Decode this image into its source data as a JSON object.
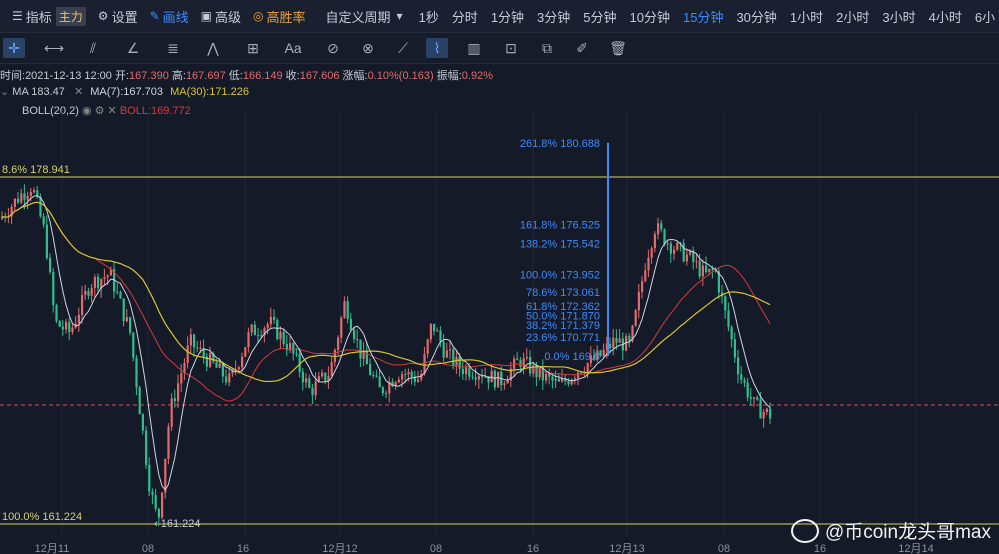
{
  "topbar": {
    "indicators_label": "指标",
    "main_badge": "主力",
    "settings_label": "设置",
    "draw_label": "画线",
    "advanced_label": "高级",
    "winrate_label": "高胜率",
    "custom_period_label": "自定义周期",
    "periods": [
      "1秒",
      "分时",
      "1分钟",
      "3分钟",
      "5分钟",
      "10分钟",
      "15分钟",
      "30分钟",
      "1小时",
      "2小时",
      "3小时",
      "4小时",
      "6小"
    ],
    "active_period": "15分钟"
  },
  "ohlc": {
    "time_label": "时间:",
    "time": "2021-12-13 12:00",
    "open_label": "开:",
    "open": "167.390",
    "high_label": "高:",
    "high": "167.697",
    "low_label": "低:",
    "low": "166.149",
    "close_label": "收:",
    "close": "167.606",
    "change_label": "涨幅:",
    "change": "0.10%(0.163)",
    "amp_label": "振幅:",
    "amp": "0.92%"
  },
  "indicators": {
    "ma_name": "MA",
    "ma_value": "183.47",
    "ma7": "MA(7):167.703",
    "ma30": "MA(30):171.226",
    "boll_name": "BOLL(20,2)",
    "boll_value": "BOLL:169.772"
  },
  "fib_levels": [
    {
      "label": "261.8% 180.688",
      "price": 180.688
    },
    {
      "label": "161.8% 176.525",
      "price": 176.525
    },
    {
      "label": "138.2% 175.542",
      "price": 175.542
    },
    {
      "label": "100.0% 173.952",
      "price": 173.952
    },
    {
      "label": "78.6% 173.061",
      "price": 173.061
    },
    {
      "label": "61.8% 172.362",
      "price": 172.362
    },
    {
      "label": "50.0% 171.870",
      "price": 171.87
    },
    {
      "label": "38.2% 171.379",
      "price": 171.379
    },
    {
      "label": "23.6% 170.771",
      "price": 170.771
    },
    {
      "label": "0.0% 169.8",
      "price": 169.8
    }
  ],
  "hlines": [
    {
      "label": "8.6% 178.941",
      "price": 178.941
    },
    {
      "label": "100.0% 161.224",
      "price": 161.224
    }
  ],
  "low_marker": "161.224",
  "last_price": 167.606,
  "x_axis": [
    "12月11",
    "08",
    "16",
    "12月12",
    "08",
    "16",
    "12月13",
    "08",
    "16",
    "12月14"
  ],
  "watermark": "@币coin龙头哥max",
  "colors": {
    "up": "#e26a6a",
    "down": "#2fbf8f",
    "ma7": "#cfd3e6",
    "ma30": "#d6c42e",
    "boll": "#d23b3b",
    "fib": "#3b8cff",
    "hline": "#d6d26a",
    "dash": "#d25050"
  }
}
